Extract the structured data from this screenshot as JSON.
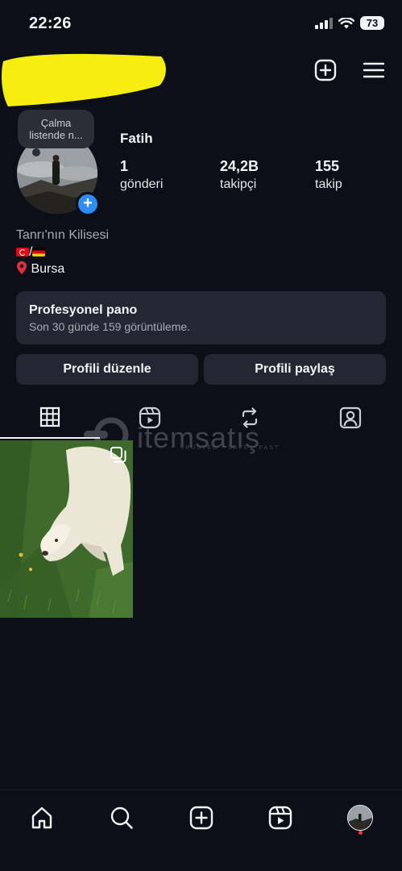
{
  "status_bar": {
    "time": "22:26",
    "battery": "73"
  },
  "note": {
    "line1": "Çalma",
    "line2": "listende n..."
  },
  "profile": {
    "name": "Fatih",
    "stats": [
      {
        "value": "1",
        "label": "gönderi"
      },
      {
        "value": "24,2B",
        "label": "takipçi"
      },
      {
        "value": "155",
        "label": "takip"
      }
    ],
    "bio": {
      "category": "Tanrı'nın Kilisesi",
      "flags_separator": "/",
      "location": "Bursa"
    }
  },
  "pro_panel": {
    "title": "Profesyonel pano",
    "subtitle": "Son 30 günde 159 görüntüleme."
  },
  "buttons": {
    "edit_profile": "Profili düzenle",
    "share_profile": "Profili paylaş"
  },
  "watermark": {
    "text": "itemsatış",
    "sub": "TRUSTED · SAFE · FAST"
  },
  "tabs": [
    "grid-icon",
    "reels-icon",
    "reposts-icon",
    "tagged-icon"
  ],
  "bottom_nav": [
    "home-icon",
    "search-icon",
    "create-icon",
    "reels-icon",
    "profile-avatar"
  ],
  "colors": {
    "background": "#0c0f18",
    "panel": "#242731",
    "accent_blue": "#2f8cf0",
    "notification_red": "#ff3040",
    "redaction_yellow": "#f6ee10"
  }
}
